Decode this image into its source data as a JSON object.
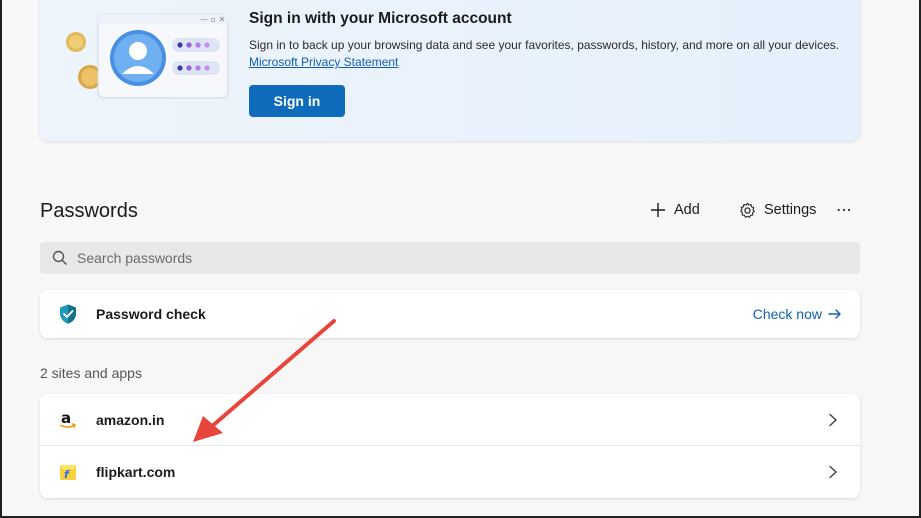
{
  "signin": {
    "title": "Sign in with your Microsoft account",
    "description": "Sign in to back up your browsing data and see your favorites, passwords, history, and more on all your devices.",
    "privacy_link": "Microsoft Privacy Statement",
    "button_label": "Sign in"
  },
  "passwords": {
    "title": "Passwords",
    "add_label": "Add",
    "settings_label": "Settings",
    "more_label": "⋯"
  },
  "search": {
    "placeholder": "Search passwords",
    "value": ""
  },
  "password_check": {
    "label": "Password check",
    "action_label": "Check now"
  },
  "sites": {
    "count_label": "2 sites and apps",
    "items": [
      {
        "name": "amazon.in",
        "icon": "amazon-icon"
      },
      {
        "name": "flipkart.com",
        "icon": "flipkart-icon"
      }
    ]
  },
  "colors": {
    "accent": "#0f6cbd",
    "link": "#0f5fb5",
    "annotation_arrow": "#e8453c",
    "shield": "#1f9bb8"
  }
}
